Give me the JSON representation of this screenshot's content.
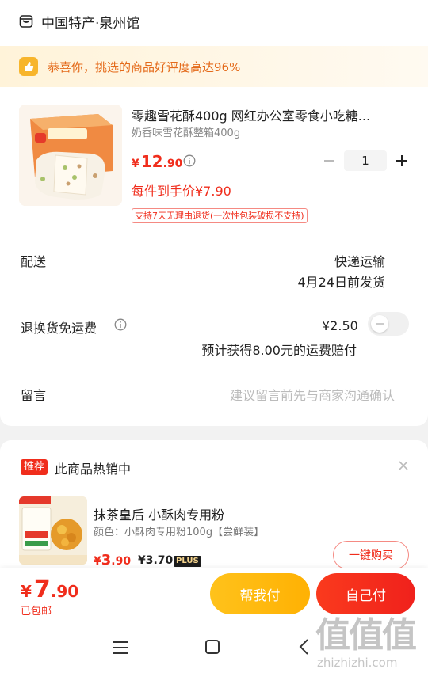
{
  "store": {
    "name": "中国特产·泉州馆"
  },
  "banner": {
    "text": "恭喜你，挑选的商品好评度高达96%"
  },
  "product": {
    "title": "零趣雪花酥400g 网红办公室零食小吃糖...",
    "spec": "奶香味雪花酥整箱400g",
    "price_currency": "¥",
    "price_int": "12",
    "price_dec": ".90",
    "quantity": "1",
    "each_price": "每件到手价¥7.90",
    "return_tag": "支持7天无理由退货(一次性包装破损不支持)"
  },
  "delivery": {
    "label": "配送",
    "method": "快递运输",
    "time": "4月24日前发货"
  },
  "return_shipping": {
    "label": "退换货免运费",
    "price": "¥2.50",
    "note": "预计获得8.00元的运费赔付",
    "toggle_on": false
  },
  "message": {
    "label": "留言",
    "placeholder": "建议留言前先与商家沟通确认"
  },
  "recommend": {
    "tag": "推荐",
    "heading": "此商品热销中",
    "title": "抹茶皇后 小酥肉专用粉",
    "spec": "颜色：小酥肉专用粉100g【尝鲜装】",
    "price_currency": "¥",
    "price_int": "3",
    "price_dec": ".90",
    "plus_price": "¥3.70",
    "plus_label": "PLUS",
    "buy_label": "一键购买"
  },
  "footer": {
    "total_currency": "¥",
    "total_int": "7",
    "total_dec": ".90",
    "shipping_note": "已包邮",
    "help_pay_label": "帮我付",
    "self_pay_label": "自己付"
  },
  "watermark": {
    "big": "值值值",
    "small": "zhizhizhi.com"
  },
  "colors": {
    "accent_red": "#f02d1c",
    "accent_yellow": "#ffb103",
    "banner_text": "#e46a1a"
  }
}
